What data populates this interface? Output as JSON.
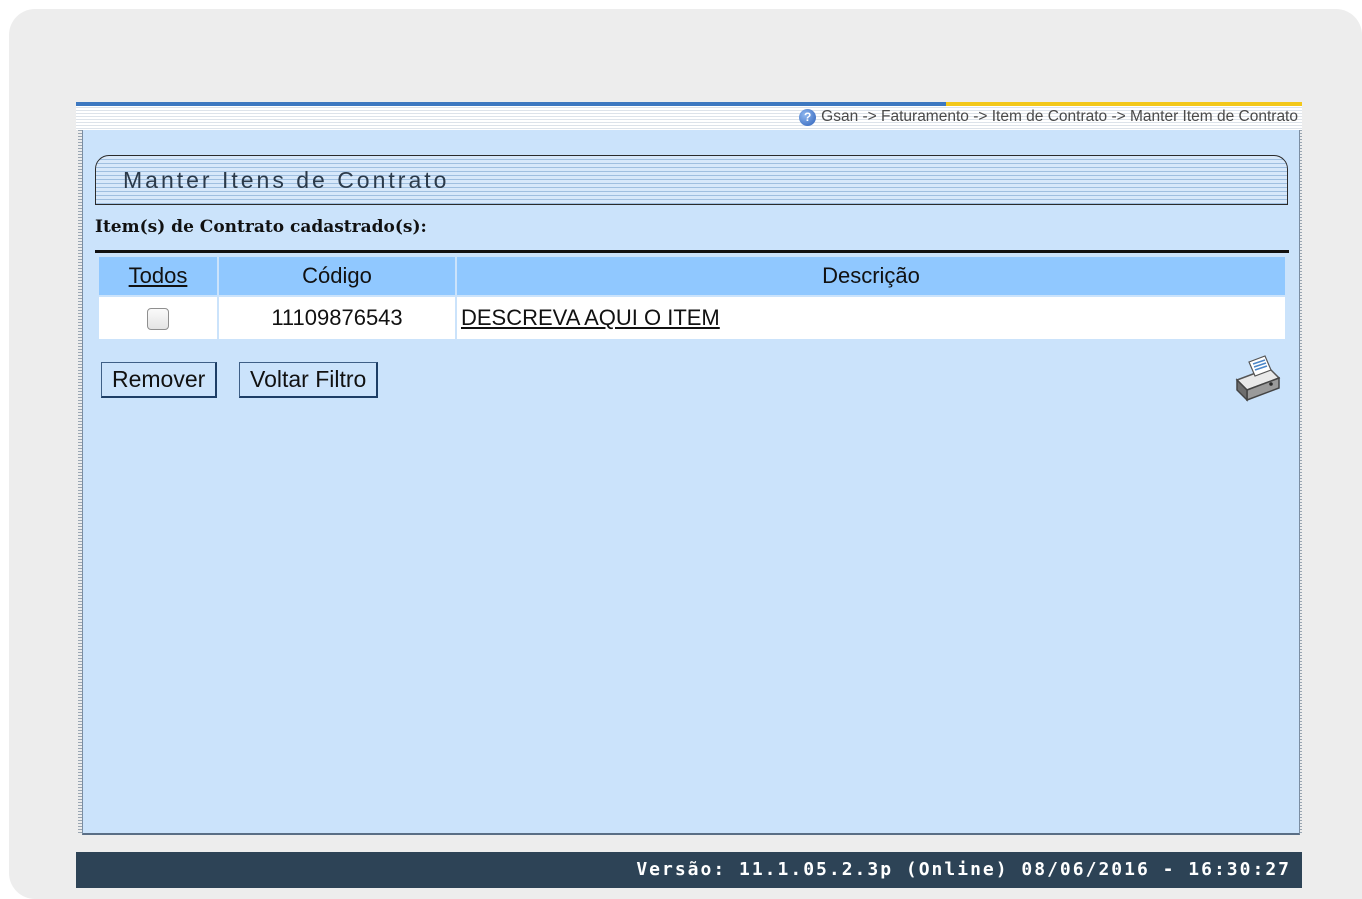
{
  "breadcrumb": {
    "text": "Gsan -> Faturamento -> Item de Contrato -> Manter Item de Contrato",
    "icon": "help-icon"
  },
  "form": {
    "title": "Manter Itens de Contrato",
    "subtitle": "Item(s) de Contrato cadastrado(s):"
  },
  "table": {
    "headers": [
      "Todos",
      "Código",
      "Descrição"
    ],
    "rows": [
      {
        "checked": false,
        "codigo": "11109876543",
        "descricao": "DESCREVA AQUI O ITEM"
      }
    ]
  },
  "buttons": {
    "remove": "Remover",
    "back": "Voltar Filtro"
  },
  "print_icon": "printer-icon",
  "footer": {
    "version": "Versão: 11.1.05.2.3p (Online) 08/06/2016 - 16:30:27"
  }
}
